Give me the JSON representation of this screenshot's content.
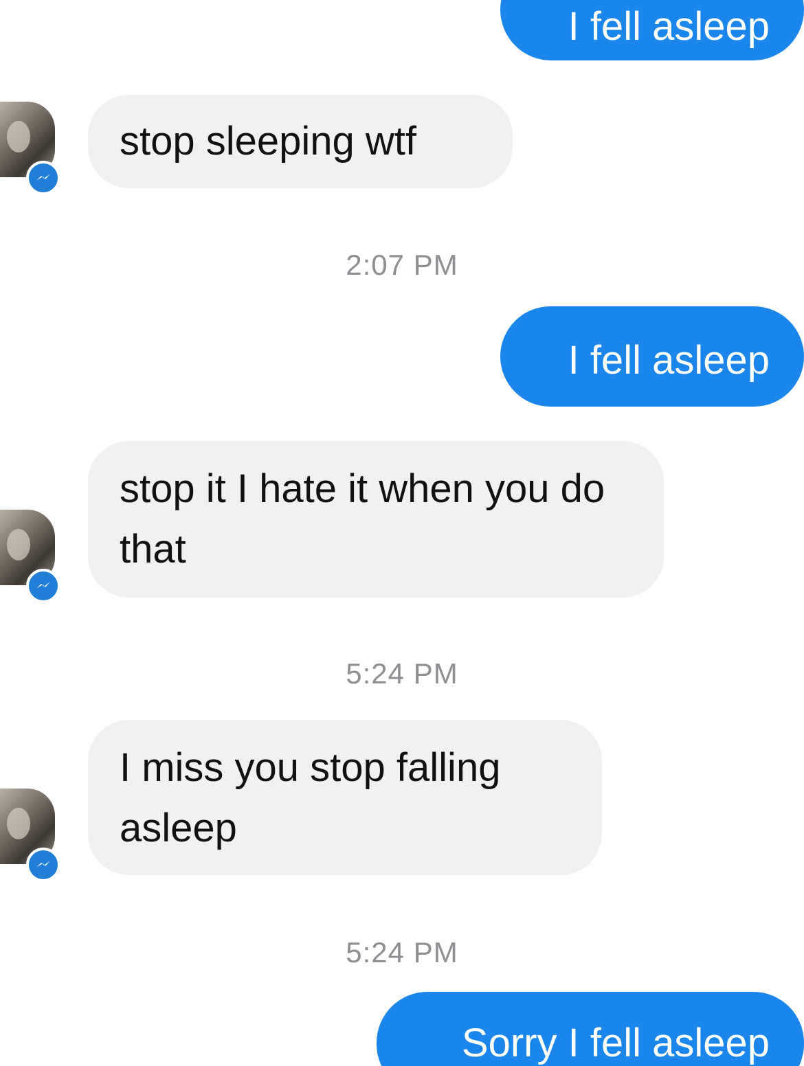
{
  "conversation": {
    "messages": [
      {
        "direction": "outgoing",
        "text": "I fell asleep"
      },
      {
        "direction": "incoming",
        "text": "stop sleeping wtf"
      },
      {
        "direction": "timestamp",
        "text": "2:07 PM"
      },
      {
        "direction": "outgoing",
        "text": "I fell asleep"
      },
      {
        "direction": "incoming",
        "text": "stop it I hate it when you do that"
      },
      {
        "direction": "timestamp",
        "text": "5:24 PM"
      },
      {
        "direction": "incoming",
        "text": "I miss you stop falling asleep"
      },
      {
        "direction": "timestamp",
        "text": "5:24 PM"
      },
      {
        "direction": "outgoing",
        "text": "Sorry I fell asleep"
      }
    ]
  },
  "icons": {
    "avatar": "contact-avatar",
    "badge": "messenger-bolt-icon"
  },
  "colors": {
    "outgoing_bubble": "#1a86ec",
    "incoming_bubble": "#f1f1f2",
    "timestamp_text": "#8e8e93",
    "messenger_badge": "#1f7fd6"
  }
}
